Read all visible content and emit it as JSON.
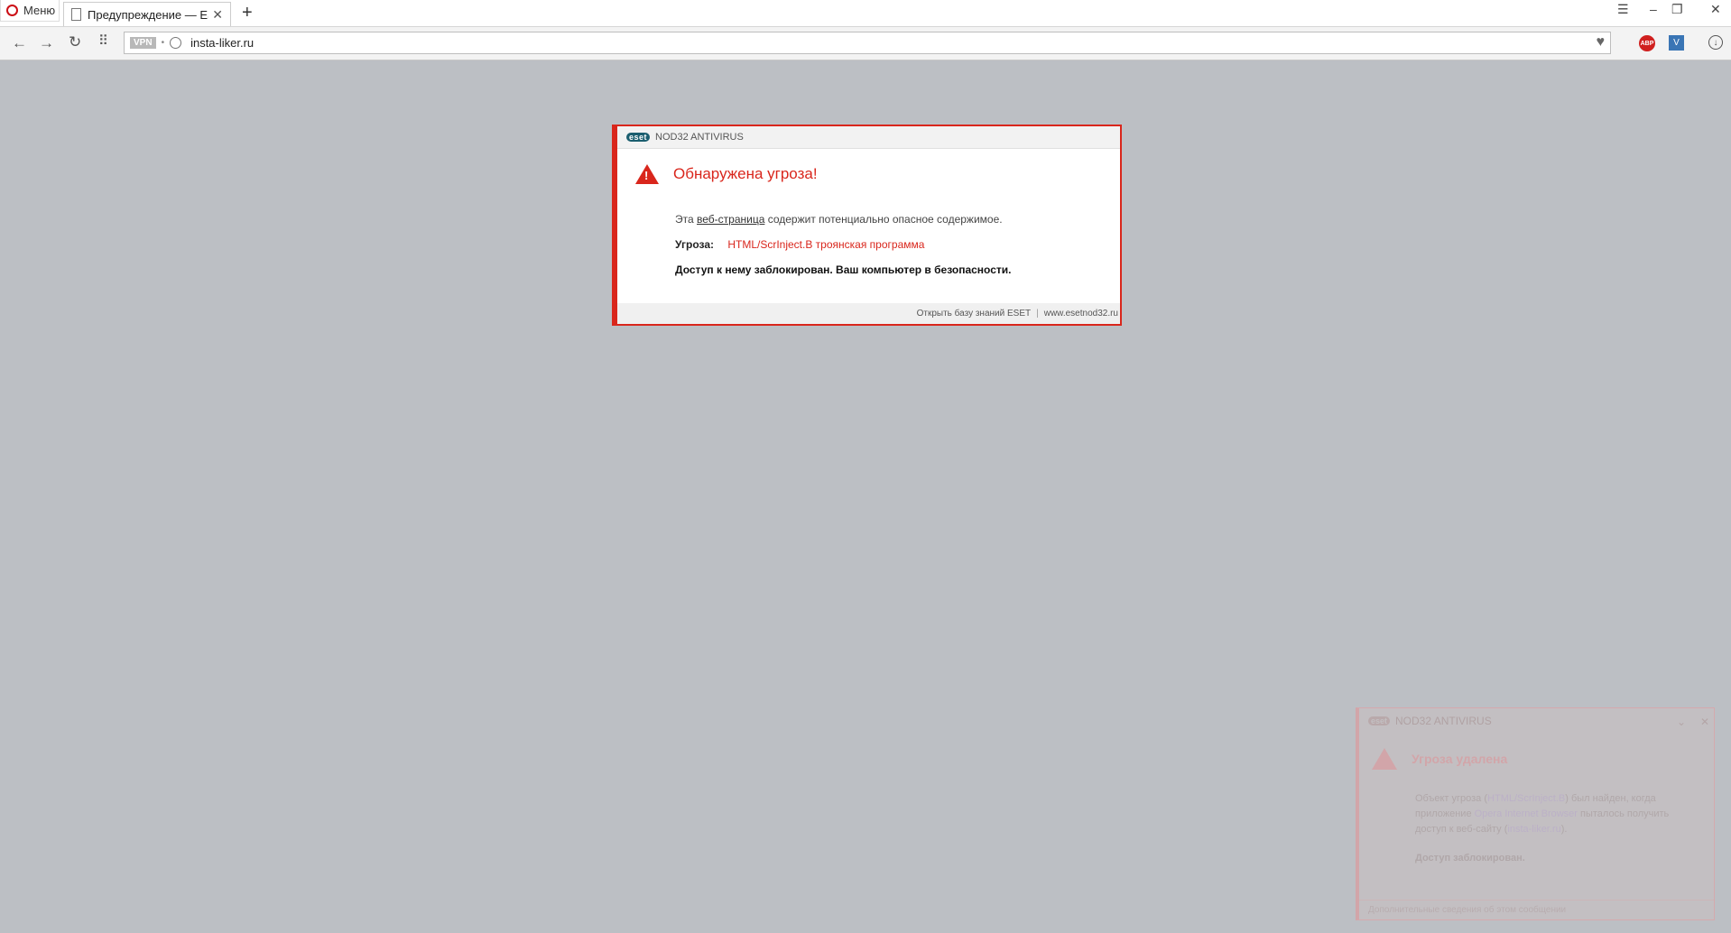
{
  "browser": {
    "menu_label": "Меню",
    "tab_title": "Предупреждение — ESET",
    "tab_close": "✕",
    "new_tab": "+",
    "vpn_badge": "VPN",
    "url": "insta-liker.ru"
  },
  "dialog": {
    "brand": "eset",
    "product": "NOD32 ANTIVIRUS",
    "title": "Обнаружена угроза!",
    "line1_prefix": "Эта ",
    "line1_link": "веб-страница",
    "line1_suffix": " содержит потенциально опасное содержимое.",
    "threat_label": "Угроза:",
    "threat_value": "HTML/ScrInject.B троянская программа",
    "blocked_text": "Доступ к нему заблокирован. Ваш компьютер в безопасности.",
    "footer_kb": "Открыть базу знаний ESET",
    "footer_sep": "|",
    "footer_site": "www.esetnod32.ru"
  },
  "notification": {
    "brand": "eset",
    "product": "NOD32 ANTIVIRUS",
    "title": "Угроза удалена",
    "body_1": "Объект угроза (",
    "body_threat": "HTML/ScrInject.B",
    "body_2": ") был найден, когда приложение ",
    "body_app": "Opera Internet Browser",
    "body_3": " пыталось получить доступ к веб-сайту (",
    "body_site": "insta-liker.ru",
    "body_4": ").",
    "blocked": "Доступ заблокирован.",
    "footer": "Дополнительные сведения об этом сообщении"
  }
}
